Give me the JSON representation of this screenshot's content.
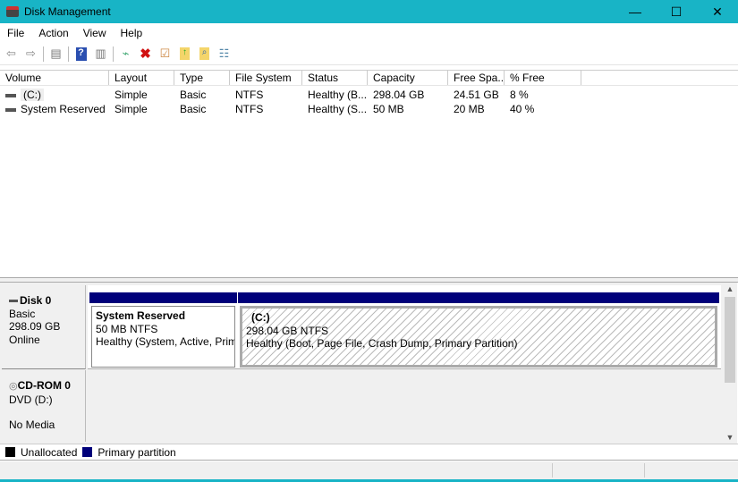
{
  "window": {
    "title": "Disk Management",
    "minimize": "—",
    "maximize": "☐",
    "close": "✕"
  },
  "menu": [
    "File",
    "Action",
    "View",
    "Help"
  ],
  "toolbar": [
    "back-icon",
    "forward-icon",
    "console-tree-icon",
    "help-icon",
    "action-pane-icon",
    "connect-icon",
    "delete-icon",
    "properties-icon",
    "folder-up-icon",
    "folder-search-icon",
    "settings-list-icon"
  ],
  "columns": [
    "Volume",
    "Layout",
    "Type",
    "File System",
    "Status",
    "Capacity",
    "Free Spa...",
    "% Free"
  ],
  "volumes": [
    [
      "(C:)",
      "Simple",
      "Basic",
      "NTFS",
      "Healthy (B...",
      "298.04 GB",
      "24.51 GB",
      "8 %"
    ],
    [
      "System Reserved",
      "Simple",
      "Basic",
      "NTFS",
      "Healthy (S...",
      "50 MB",
      "20 MB",
      "40 %"
    ]
  ],
  "disks": {
    "disk0": {
      "name": "Disk 0",
      "type": "Basic",
      "size": "298.09 GB",
      "state": "Online",
      "partitions": [
        {
          "name": "System Reserved",
          "size": "50 MB NTFS",
          "status": "Healthy (System, Active, Prima"
        },
        {
          "name": "(C:)",
          "size": "298.04 GB NTFS",
          "status": "Healthy (Boot, Page File, Crash Dump, Primary Partition)"
        }
      ]
    },
    "cdrom0": {
      "name": "CD-ROM 0",
      "type": "DVD (D:)",
      "state": "No Media"
    }
  },
  "legend": [
    {
      "label": "Unallocated",
      "color": "#000000"
    },
    {
      "label": "Primary partition",
      "color": "#00007a"
    }
  ]
}
